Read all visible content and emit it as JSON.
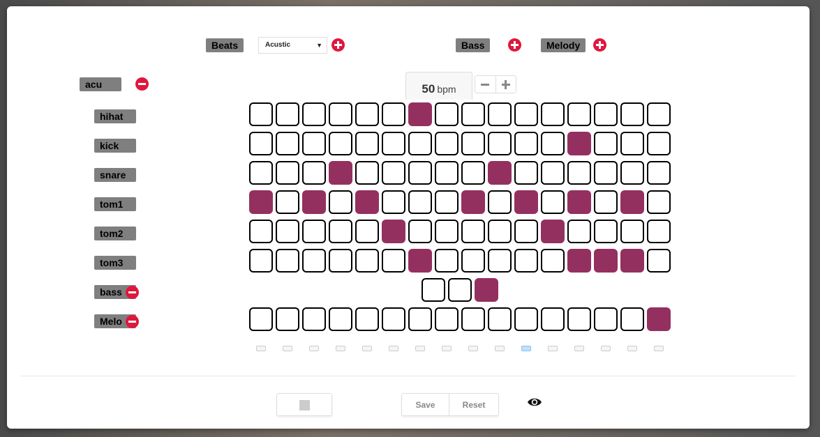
{
  "header": {
    "beats_label": "Beats",
    "kit_select_value": "Acustic",
    "bass_label": "Bass",
    "melody_label": "Melody"
  },
  "tempo": {
    "value": "50",
    "unit": "bpm"
  },
  "kit_name": "acu",
  "tracks": [
    {
      "label": "hihat",
      "steps": [
        0,
        0,
        0,
        0,
        0,
        0,
        1,
        0,
        0,
        0,
        0,
        0,
        0,
        0,
        0,
        0
      ]
    },
    {
      "label": "kick",
      "steps": [
        0,
        0,
        0,
        0,
        0,
        0,
        0,
        0,
        0,
        0,
        0,
        0,
        1,
        0,
        0,
        0
      ]
    },
    {
      "label": "snare",
      "steps": [
        0,
        0,
        0,
        1,
        0,
        0,
        0,
        0,
        0,
        1,
        0,
        0,
        0,
        0,
        0,
        0
      ]
    },
    {
      "label": "tom1",
      "steps": [
        1,
        0,
        1,
        0,
        1,
        0,
        0,
        0,
        1,
        0,
        1,
        0,
        1,
        0,
        1,
        0
      ]
    },
    {
      "label": "tom2",
      "steps": [
        0,
        0,
        0,
        0,
        0,
        1,
        0,
        0,
        0,
        0,
        0,
        1,
        0,
        0,
        0,
        0
      ]
    },
    {
      "label": "tom3",
      "steps": [
        0,
        0,
        0,
        0,
        0,
        0,
        1,
        0,
        0,
        0,
        0,
        0,
        1,
        1,
        1,
        0
      ]
    }
  ],
  "bass": {
    "label": "bass",
    "steps": [
      0,
      0,
      1
    ]
  },
  "melody": {
    "label": "Melo",
    "steps": [
      0,
      0,
      0,
      0,
      0,
      0,
      0,
      0,
      0,
      0,
      0,
      0,
      0,
      0,
      0,
      1
    ]
  },
  "playhead": {
    "count": 16,
    "active_index": 10
  },
  "footer": {
    "save_label": "Save",
    "reset_label": "Reset"
  },
  "colors": {
    "active_step": "#943060",
    "remove": "#e0173d",
    "label_bg": "#7f7f7f"
  },
  "icons": {
    "add": "plus-circle-icon",
    "remove": "minus-circle-icon",
    "preview": "eye-icon",
    "stop": "stop-icon"
  }
}
